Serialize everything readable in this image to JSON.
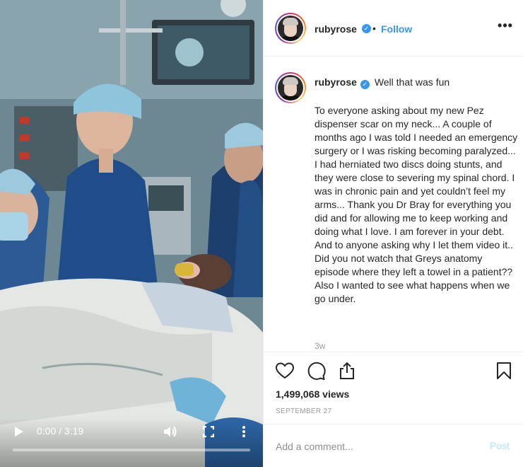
{
  "video": {
    "time_display": "0:00 / 3:19",
    "progress": 0.0,
    "icons": {
      "play": "play-icon",
      "volume": "volume-icon",
      "fullscreen": "fullscreen-icon",
      "more": "more-vertical-icon"
    }
  },
  "header": {
    "username": "rubyrose",
    "verified_icon": "verified-badge-icon",
    "separator": "•",
    "follow_label": "Follow",
    "more_label": "•••"
  },
  "caption": {
    "username": "rubyrose",
    "title": "Well that was fun",
    "text": "To everyone asking about my new Pez dispenser scar on my neck... A couple of months ago I was told I needed an emergency surgery or I was risking becoming paralyzed... I had herniated two discs doing stunts, and they were close to severing my spinal chord. I was in chronic pain and yet couldn’t feel my arms... Thank you Dr Bray for everything you did and for allowing me to keep working and doing what I love. I am forever in your debt. And to anyone asking why I let them video it.. Did you not watch that Greys anatomy episode where they left a towel in a patient?? Also I wanted to see what happens when we go under.",
    "timestamp": "3w"
  },
  "actions": {
    "icons": [
      "heart-icon",
      "comment-icon",
      "share-icon",
      "bookmark-icon"
    ],
    "views": "1,499,068 views",
    "date": "SEPTEMBER 27"
  },
  "comment_box": {
    "placeholder": "Add a comment...",
    "post_label": "Post"
  },
  "colors": {
    "accent": "#3897f0",
    "post_disabled": "#b2dffc",
    "muted": "#999999",
    "border": "#efefef"
  }
}
